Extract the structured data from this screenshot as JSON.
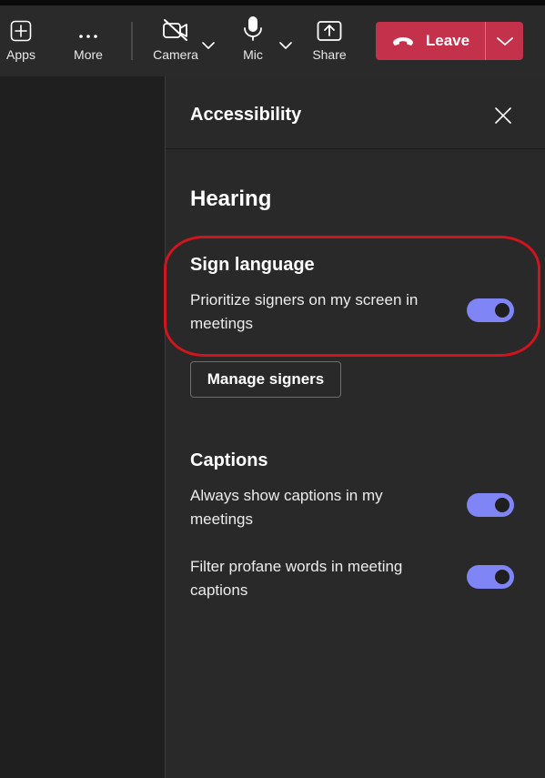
{
  "toolbar": {
    "apps_label": "Apps",
    "more_label": "More",
    "camera_label": "Camera",
    "mic_label": "Mic",
    "share_label": "Share",
    "leave_label": "Leave"
  },
  "panel": {
    "title": "Accessibility",
    "hearing": {
      "title": "Hearing",
      "sign_language": {
        "title": "Sign language",
        "prioritize_label": "Prioritize signers on my screen in meetings",
        "prioritize_on": true,
        "manage_button": "Manage signers"
      },
      "captions": {
        "title": "Captions",
        "always_show_label": "Always show captions in my meetings",
        "always_show_on": true,
        "filter_label": "Filter profane words in meeting captions",
        "filter_on": true
      }
    }
  },
  "colors": {
    "toggle_on": "#7f85f5",
    "leave_red": "#c4314b",
    "highlight_red": "#d1141e",
    "panel_bg": "#292929",
    "toolbar_bg": "#2a2a2a"
  },
  "icons": [
    "add-app-icon",
    "more-dots-icon",
    "camera-off-icon",
    "chevron-down-icon",
    "mic-icon",
    "share-upload-icon",
    "phone-hangup-icon",
    "close-icon"
  ]
}
